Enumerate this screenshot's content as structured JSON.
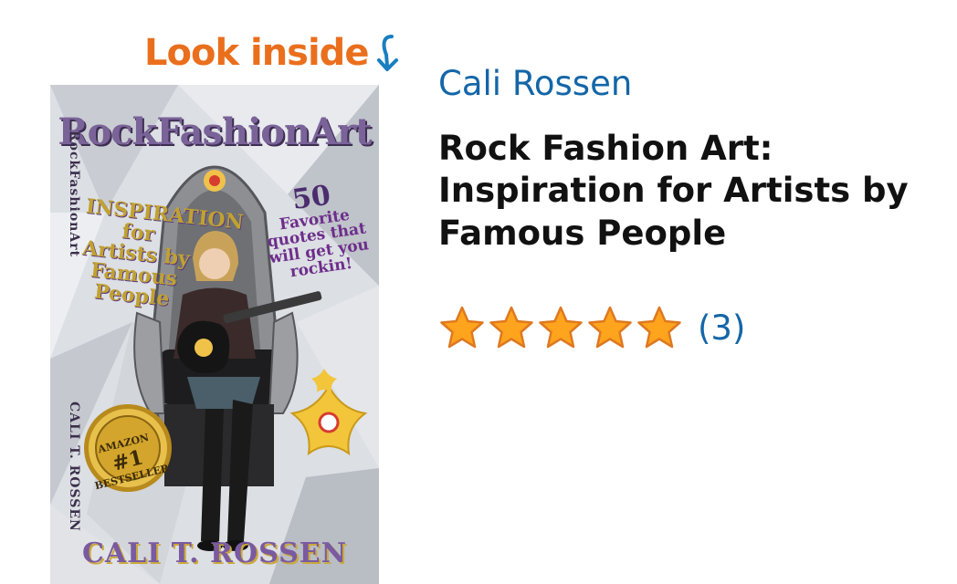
{
  "look_inside": {
    "label": "Look inside",
    "icon": "curved-down-arrow-icon",
    "color": "#ea6f1d",
    "arrow_color": "#1a7fc1"
  },
  "cover": {
    "title_text": "RockFashionArt",
    "spine_title": "RockFashionArt",
    "spine_author": "CALI T. ROSSEN",
    "inspiration_text": "INSPIRATION for Artists by Famous People",
    "quotes_number": "50",
    "quotes_text": "Favorite quotes that will get you rockin!",
    "badge_top": "AMAZON",
    "badge_number": "#1",
    "badge_bottom": "BESTSELLER",
    "author_text": "CALI T. ROSSEN"
  },
  "author": {
    "name": "Cali Rossen",
    "color": "#1466a8"
  },
  "book": {
    "title": "Rock Fashion Art: Inspiration for Artists by Famous People"
  },
  "rating": {
    "stars": 5,
    "max_stars": 5,
    "star_color": "#ffa41c",
    "review_count": "(3)"
  }
}
